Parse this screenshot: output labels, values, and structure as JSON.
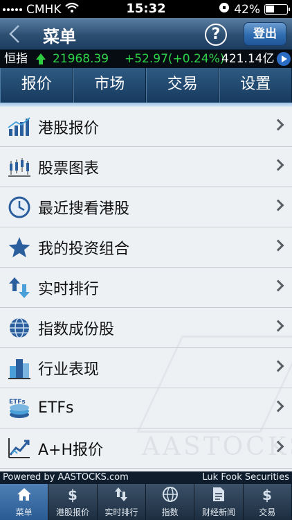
{
  "status": {
    "carrier": "CMHK",
    "time": "15:32",
    "battery": "42%"
  },
  "header": {
    "title": "菜单",
    "help": "?",
    "logout": "登出"
  },
  "ticker": {
    "name": "恒指",
    "value": "21968.39",
    "change": "+52.97(+0.24%)",
    "turnover": "421.14亿"
  },
  "tabs": [
    {
      "label": "报价"
    },
    {
      "label": "市场"
    },
    {
      "label": "交易"
    },
    {
      "label": "设置"
    }
  ],
  "menu": [
    {
      "label": "港股报价",
      "icon": "hk-quote-chart-icon"
    },
    {
      "label": "股票图表",
      "icon": "candlestick-icon"
    },
    {
      "label": "最近搜看港股",
      "icon": "clock-icon"
    },
    {
      "label": "我的投资组合",
      "icon": "star-icon"
    },
    {
      "label": "实时排行",
      "icon": "up-down-arrows-icon"
    },
    {
      "label": "指数成份股",
      "icon": "globe-icon"
    },
    {
      "label": "行业表现",
      "icon": "buildings-icon"
    },
    {
      "label": "ETFs",
      "icon": "etf-coins-icon"
    },
    {
      "label": "A+H报价",
      "icon": "ah-chart-icon"
    }
  ],
  "watermark": "AASTOCKS",
  "footer": {
    "powered": "Powered by AASTOCKS.com",
    "broker": "Luk Fook Securities"
  },
  "bottomnav": [
    {
      "label": "菜单",
      "icon": "home-icon"
    },
    {
      "label": "港股报价",
      "icon": "dollar-icon"
    },
    {
      "label": "实时排行",
      "icon": "sort-arrows-icon"
    },
    {
      "label": "指数",
      "icon": "globe-icon"
    },
    {
      "label": "财经新闻",
      "icon": "news-icon"
    },
    {
      "label": "交易",
      "icon": "dollar-icon"
    }
  ],
  "colors": {
    "accent": "#2a5b93",
    "up": "#2ed44a"
  }
}
